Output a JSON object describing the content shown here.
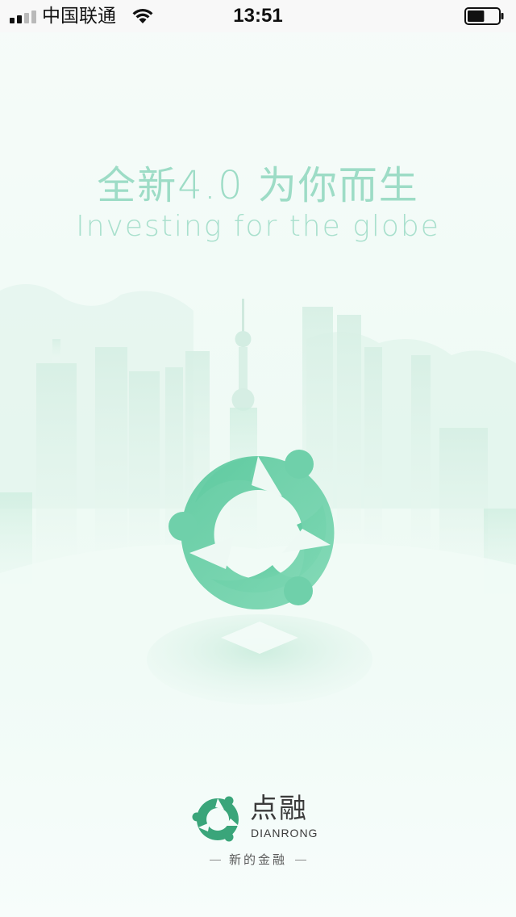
{
  "status_bar": {
    "carrier": "中国联通",
    "time": "13:51",
    "signal_bars_active": 2,
    "signal_bars_total": 4,
    "wifi_icon": "wifi-icon",
    "battery_icon": "battery-icon",
    "battery_level": 0.55
  },
  "splash": {
    "slogan_cn": "全新4.0  为你而生",
    "slogan_en": "Investing for the globe",
    "hero_logo_icon": "dianrong-logo-icon"
  },
  "brand": {
    "name_cn": "点融",
    "name_en": "DIANRONG",
    "tagline": "新的金融",
    "logo_icon": "dianrong-logo-icon"
  },
  "colors": {
    "accent": "#5fcaa0",
    "accent_dark": "#3aa57a",
    "slogan": "#9ddcc6",
    "background": "#f2fbf7"
  }
}
